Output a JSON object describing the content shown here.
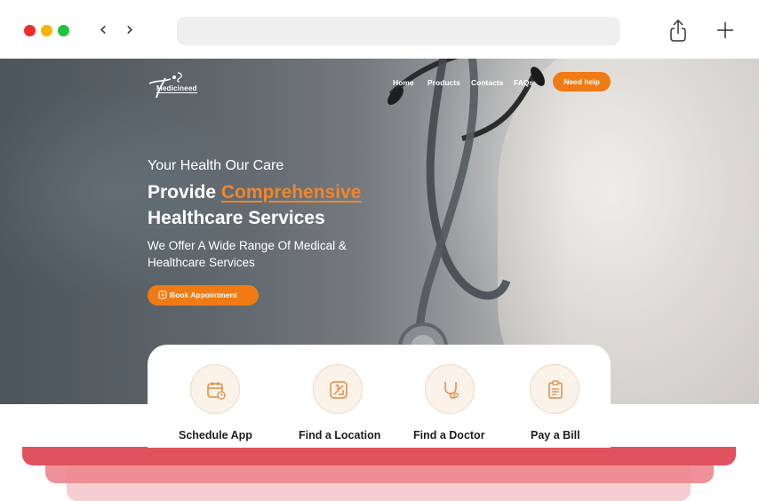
{
  "browser": {
    "back_glyph": "‹",
    "forward_glyph": "›",
    "address_value": "",
    "icons": [
      "share-icon",
      "new-tab-icon"
    ]
  },
  "site": {
    "brand": "Medicineed",
    "nav": [
      {
        "label": "Home"
      },
      {
        "label": "Products"
      },
      {
        "label": "Contacts"
      },
      {
        "label": "FAQs"
      }
    ],
    "help_label": "Need help"
  },
  "hero": {
    "kicker": "Your Health Our Care",
    "headline_prefix": "Provide ",
    "headline_accent": "Comprehensive",
    "headline_line2": "Healthcare Services",
    "subtitle": "We Offer A Wide Range Of Medical & Healthcare Services",
    "cta_label": "Book Appointment"
  },
  "services": [
    {
      "label": "Schedule App",
      "icon": "calendar-icon"
    },
    {
      "label": "Find a Location",
      "icon": "map-icon"
    },
    {
      "label": "Find a Doctor",
      "icon": "stethoscope-icon"
    },
    {
      "label": "Pay a Bill",
      "icon": "bill-icon"
    }
  ],
  "colors": {
    "accent": "#f07a14",
    "accent_text": "#f2862a",
    "bar_red": "#e0525d",
    "bar_mid": "#ed8d94",
    "bar_light": "#f6cdd0"
  }
}
